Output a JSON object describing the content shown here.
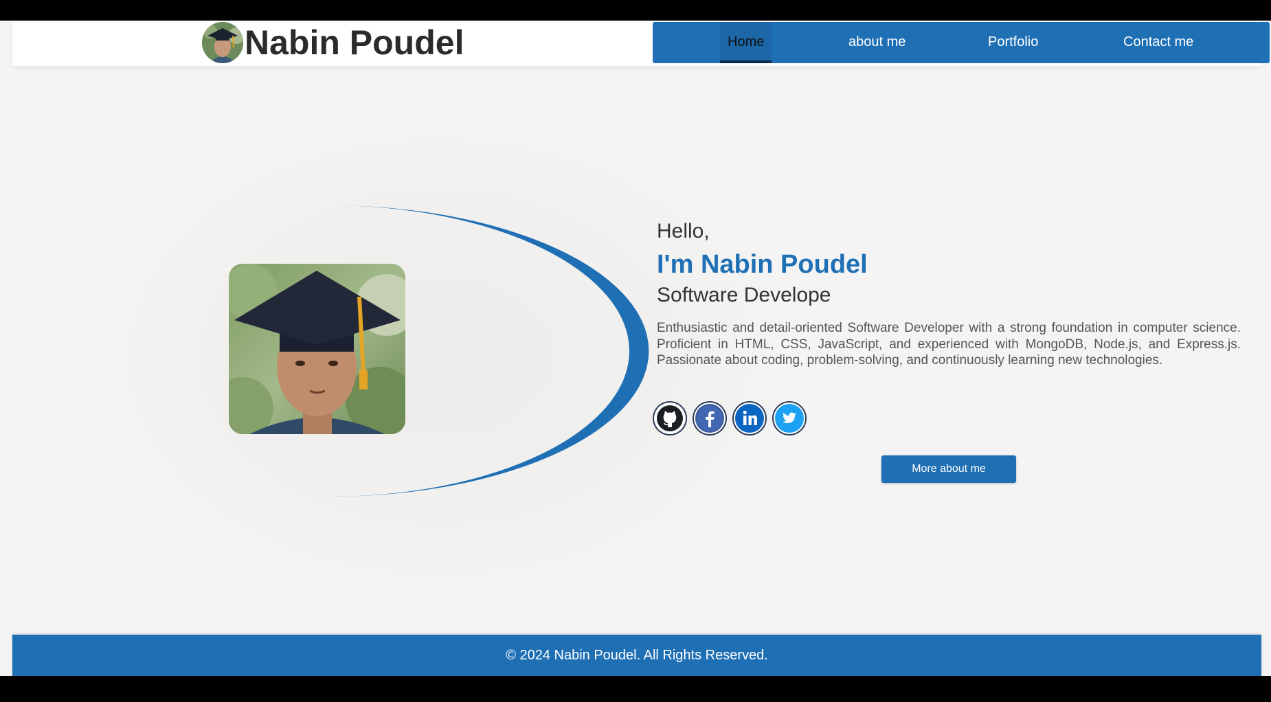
{
  "header": {
    "brand_name": "Nabin Poudel",
    "nav": [
      {
        "label": "Home",
        "active": true
      },
      {
        "label": "about me",
        "active": false
      },
      {
        "label": "Portfolio",
        "active": false
      },
      {
        "label": "Contact me",
        "active": false
      }
    ]
  },
  "hero": {
    "greeting": "Hello,",
    "name_line": "I'm Nabin Poudel",
    "role": "Software Develope",
    "bio": "Enthusiastic and detail-oriented Software Developer with a strong foundation in computer sci­ence. Proficient in HTML, CSS, JavaScript, and experienced with MongoDB, Node.js, and Express.js. Passionate about coding, problem-solving, and continuously learning new technologies.",
    "socials": [
      {
        "icon": "github-icon",
        "color": "#1b1f23"
      },
      {
        "icon": "facebook-icon",
        "color": "#3b5998"
      },
      {
        "icon": "linkedin-icon",
        "color": "#0a66c2"
      },
      {
        "icon": "twitter-icon",
        "color": "#1da1f2"
      }
    ],
    "cta_label": "More about me"
  },
  "footer": {
    "copyright": "© 2024 Nabin Poudel. All Rights Reserved."
  },
  "colors": {
    "accent": "#1f6fb5",
    "page_background": "#f4f4f4",
    "text_dark": "#333333"
  }
}
